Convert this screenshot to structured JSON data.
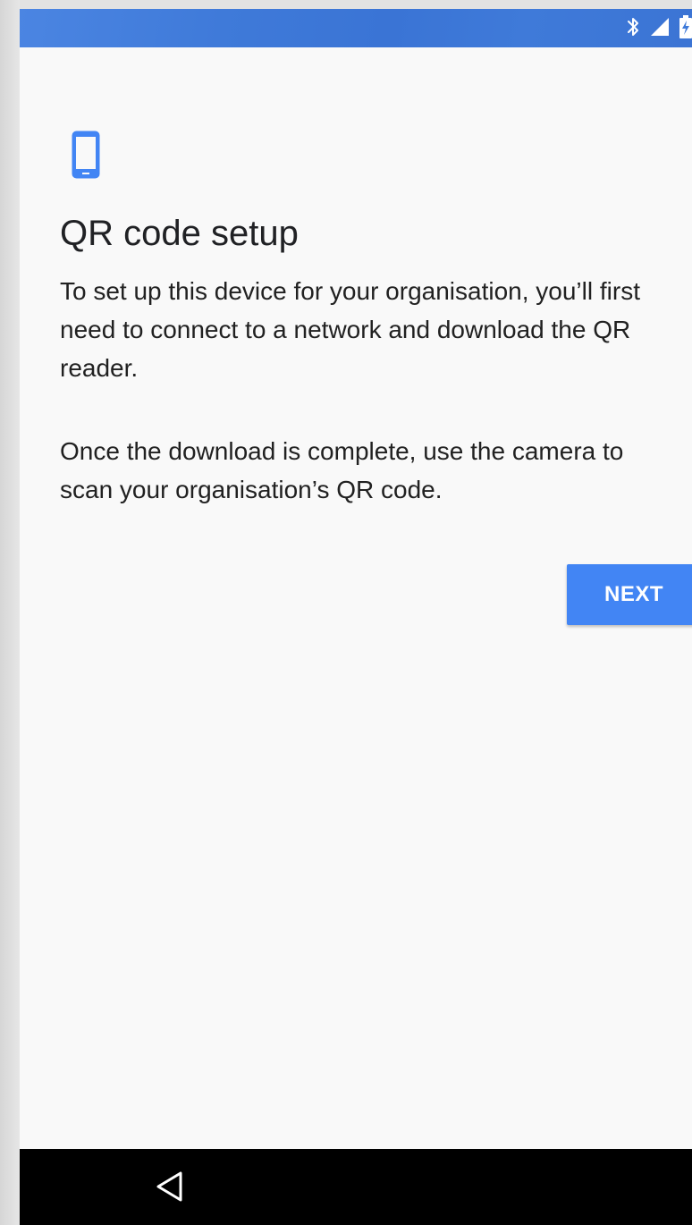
{
  "status_bar": {
    "icons": [
      "bluetooth-icon",
      "signal-icon",
      "battery-charging-icon"
    ],
    "color": "#3f7ad9"
  },
  "setup": {
    "icon": "smartphone-icon",
    "title": "QR code setup",
    "paragraph_1": "To set up this device for your organisation, you’ll first need to connect to a network and download the QR reader.",
    "paragraph_2": "Once the download is complete, use the camera to scan your organisation’s QR code.",
    "next_label": "NEXT",
    "accent_color": "#4285f4"
  },
  "nav_bar": {
    "icons": [
      "back-icon"
    ]
  }
}
